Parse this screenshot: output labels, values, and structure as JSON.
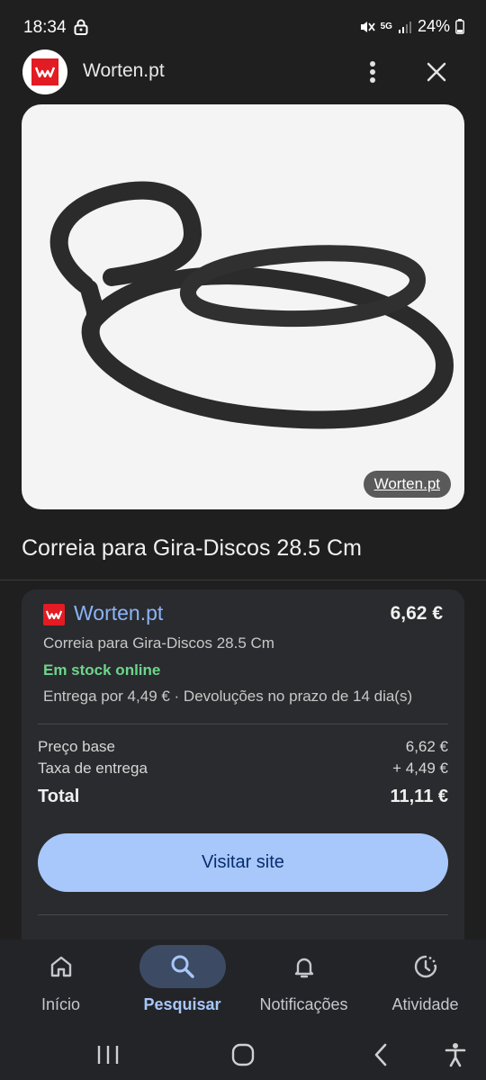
{
  "status_bar": {
    "time": "18:34",
    "network": "5G",
    "battery": "24%"
  },
  "header": {
    "site_name": "Worten.pt",
    "logo_icon": "worten-logo-icon",
    "more_icon": "more-vert-icon",
    "close_icon": "close-icon"
  },
  "image": {
    "badge": "Worten.pt"
  },
  "product": {
    "title": "Correia para Gira-Discos 28.5 Cm"
  },
  "offer": {
    "seller": "Worten.pt",
    "price": "6,62 €",
    "product_name": "Correia para Gira-Discos 28.5 Cm",
    "stock": "Em stock online",
    "delivery": "Entrega por 4,49 € · Devoluções no prazo de 14 dia(s)",
    "breakdown": [
      {
        "label": "Preço base",
        "value": "6,62 €"
      },
      {
        "label": "Taxa de entrega",
        "value": "+ 4,49 €"
      }
    ],
    "total_label": "Total",
    "total_value": "11,11 €",
    "visit_label": "Visitar site"
  },
  "bottom_nav": {
    "items": [
      {
        "label": "Início",
        "icon": "home-icon"
      },
      {
        "label": "Pesquisar",
        "icon": "search-icon",
        "active": true
      },
      {
        "label": "Notificações",
        "icon": "bell-icon"
      },
      {
        "label": "Atividade",
        "icon": "activity-icon"
      }
    ]
  },
  "colors": {
    "background": "#1f1f1f",
    "card": "#2a2b2e",
    "accent": "#a8c7fa",
    "link": "#8ab4f8",
    "stock_green": "#6dd58c",
    "brand_red": "#e31b23"
  }
}
